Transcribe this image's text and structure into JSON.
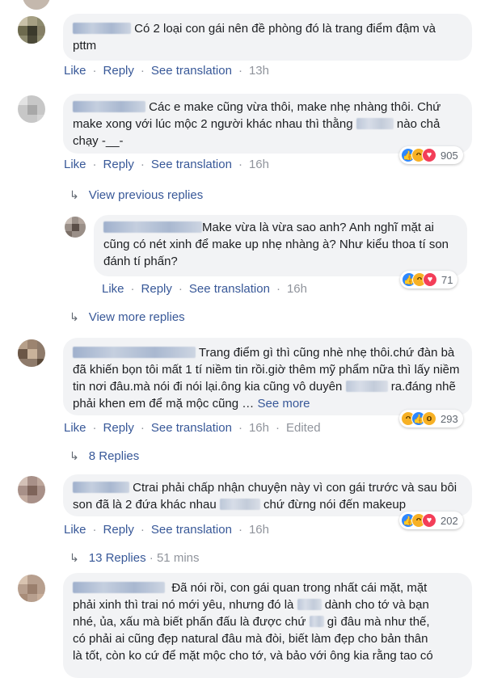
{
  "comments": [
    {
      "text": "Có 2 loại con gái nên đề phòng đó là trang điểm đậm và pttm",
      "time": "13h"
    },
    {
      "text_a": "Các e make cũng vừa thôi, make nhẹ nhàng thôi. Chứ make xong với lúc mộc 2 người khác nhau thì thằng",
      "text_b": "nào chả chạy -__-",
      "time": "16h",
      "reactions": "905"
    },
    {
      "text": "Make vừa là vừa sao anh? Anh nghĩ mặt ai cũng có nét xinh để make up nhẹ nhàng à? Như kiểu thoa tí son đánh tí phấn?",
      "time": "16h",
      "reactions": "71"
    },
    {
      "text_a": "Trang điểm gì thì cũng nhè nhẹ thôi.chứ đàn bà đã khiến bọn tôi mất 1 tí niềm tin rồi.giờ thêm mỹ phẩm nữa thì lấy niềm tin nơi đâu.mà nói đi nói lại.ông kia cũng vô duyên",
      "text_b": "ra.đáng nhẽ phải khen em để mặ mộc cũng …",
      "see_more": "See more",
      "time": "16h",
      "edited": "Edited",
      "reactions": "293"
    },
    {
      "text_a": "Ctrai phải chấp nhận chuyện này vì con gái trước và sau bôi son đã là 2 đứa khác nhau",
      "text_b": "chứ đừng nói đến makeup",
      "time": "16h",
      "reactions": "202"
    },
    {
      "line1": "Đã nói rồi, con gái quan trong nhất cái mặt, mặt",
      "line2": "phải xinh thì trai nó mới yêu, nhưng đó là",
      "line2b": "dành cho tớ và bạn",
      "line3": "nhé, ủa, xấu mà biết phấn đấu là được chứ",
      "line3b": "gì đâu mà như thế,",
      "line4": "có phải ai cũng đẹp natural đâu mà đòi, biết làm đẹp cho bản thân",
      "line5": "là tốt, còn ko cứ để mặt mộc cho tớ, và bảo với ông kia rằng tao có"
    }
  ],
  "actions": {
    "like": "Like",
    "reply": "Reply",
    "see_translation": "See translation"
  },
  "reply_links": {
    "view_previous": "View previous replies",
    "view_more": "View more replies",
    "eight_replies": "8 Replies",
    "thirteen_replies": "13 Replies",
    "thirteen_time": "51 mins"
  },
  "colors": {
    "link": "#385898",
    "muted": "#90949c",
    "bubble": "#f2f3f5",
    "like": "#2d88ff",
    "love": "#f33e58",
    "haha": "#f7b125"
  }
}
